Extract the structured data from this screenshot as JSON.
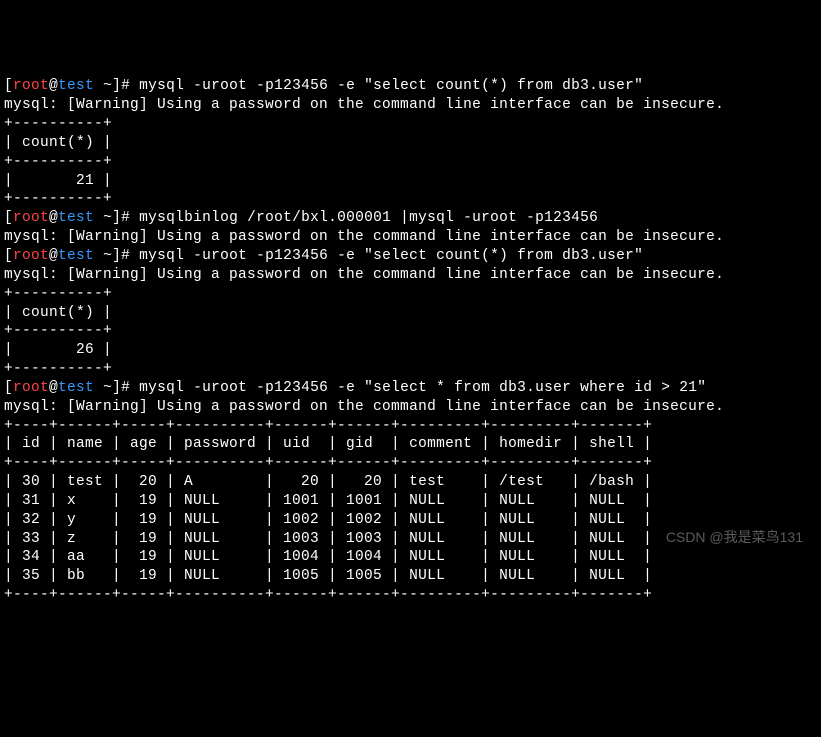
{
  "prompt": {
    "open": "[",
    "user": "root",
    "at": "@",
    "host": "test",
    "space": " ",
    "tilde": "~",
    "close": "]# "
  },
  "commands": {
    "cmd1": "mysql -uroot -p123456 -e \"select count(*) from db3.user\"",
    "cmd2": "mysqlbinlog /root/bxl.000001 |mysql -uroot -p123456",
    "cmd3": "mysql -uroot -p123456 -e \"select count(*) from db3.user\"",
    "cmd4": "mysql -uroot -p123456 -e \"select * from db3.user where id > 21\""
  },
  "warning": "mysql: [Warning] Using a password on the command line interface can be insecure.",
  "count_table": {
    "border": "+----------+",
    "header": "| count(*) |",
    "row1": "|       21 |",
    "row2": "|       26 |"
  },
  "user_table": {
    "border": "+----+------+-----+----------+------+------+---------+---------+-------+",
    "header": "| id | name | age | password | uid  | gid  | comment | homedir | shell |",
    "rows": [
      "| 30 | test |  20 | A        |   20 |   20 | test    | /test   | /bash |",
      "| 31 | x    |  19 | NULL     | 1001 | 1001 | NULL    | NULL    | NULL  |",
      "| 32 | y    |  19 | NULL     | 1002 | 1002 | NULL    | NULL    | NULL  |",
      "| 33 | z    |  19 | NULL     | 1003 | 1003 | NULL    | NULL    | NULL  |",
      "| 34 | aa   |  19 | NULL     | 1004 | 1004 | NULL    | NULL    | NULL  |",
      "| 35 | bb   |  19 | NULL     | 1005 | 1005 | NULL    | NULL    | NULL  |"
    ]
  },
  "watermark": "CSDN @我是菜鸟131",
  "chart_data": {
    "type": "table",
    "title": "db3.user where id > 21",
    "columns": [
      "id",
      "name",
      "age",
      "password",
      "uid",
      "gid",
      "comment",
      "homedir",
      "shell"
    ],
    "rows": [
      [
        30,
        "test",
        20,
        "A",
        20,
        20,
        "test",
        "/test",
        "/bash"
      ],
      [
        31,
        "x",
        19,
        null,
        1001,
        1001,
        null,
        null,
        null
      ],
      [
        32,
        "y",
        19,
        null,
        1002,
        1002,
        null,
        null,
        null
      ],
      [
        33,
        "z",
        19,
        null,
        1003,
        1003,
        null,
        null,
        null
      ],
      [
        34,
        "aa",
        19,
        null,
        1004,
        1004,
        null,
        null,
        null
      ],
      [
        35,
        "bb",
        19,
        null,
        1005,
        1005,
        null,
        null,
        null
      ]
    ],
    "counts": {
      "before_restore": 21,
      "after_restore": 26
    }
  }
}
